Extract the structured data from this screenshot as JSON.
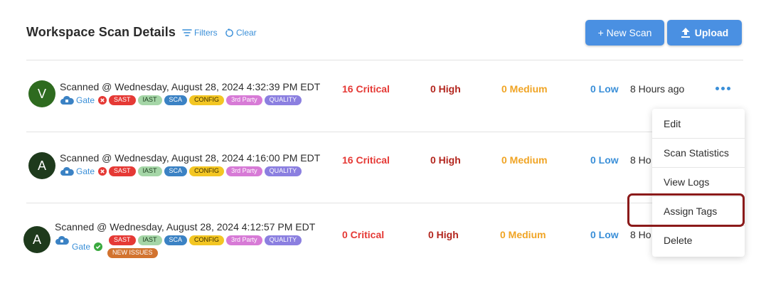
{
  "header": {
    "title": "Workspace Scan Details",
    "filters_label": "Filters",
    "clear_label": "Clear",
    "new_scan_label": "+ New Scan",
    "upload_label": "Upload"
  },
  "rows": [
    {
      "avatar_letter": "V",
      "avatar_color": "#2e6b1f",
      "title": "Scanned @ Wednesday, August 28, 2024 4:32:39 PM EDT",
      "gate_label": "Gate",
      "gate_status": "failed",
      "tags": [
        "SAST",
        "IAST",
        "SCA",
        "CONFIG",
        "3rd Party",
        "QUALITY"
      ],
      "critical": "16 Critical",
      "high": "0 High",
      "medium": "0 Medium",
      "low": "0 Low",
      "ago": "8 Hours ago"
    },
    {
      "avatar_letter": "A",
      "avatar_color": "#1e3a1c",
      "title": "Scanned @ Wednesday, August 28, 2024 4:16:00 PM EDT",
      "gate_label": "Gate",
      "gate_status": "failed",
      "tags": [
        "SAST",
        "IAST",
        "SCA",
        "CONFIG",
        "3rd Party",
        "QUALITY"
      ],
      "critical": "16 Critical",
      "high": "0 High",
      "medium": "0 Medium",
      "low": "0 Low",
      "ago": "8 Ho"
    },
    {
      "avatar_letter": "A",
      "avatar_color": "#1e3a1c",
      "title": "Scanned @ Wednesday, August 28, 2024 4:12:57 PM EDT",
      "gate_label": "Gate",
      "gate_status": "passed",
      "tags": [
        "SAST",
        "IAST",
        "SCA",
        "CONFIG",
        "3rd Party",
        "QUALITY"
      ],
      "extra_tag": "NEW ISSUES",
      "critical": "0 Critical",
      "high": "0 High",
      "medium": "0 Medium",
      "low": "0 Low",
      "ago": "8 Ho"
    }
  ],
  "menu": {
    "items": [
      "Edit",
      "Scan Statistics",
      "View Logs",
      "Assign Tags",
      "Delete"
    ],
    "highlighted": "Assign Tags"
  },
  "colors": {
    "accent": "#4a90e2",
    "link": "#3a8fd8",
    "critical": "#e53935",
    "high": "#b3261e",
    "medium": "#f0a424",
    "highlight_border": "#8b1a1a"
  },
  "icons": {
    "filters": "filter-lines-icon",
    "clear": "refresh-icon",
    "upload": "upload-arrow-icon",
    "gate": "cloud-lock-icon",
    "gate_failed": "x-circle-icon",
    "gate_passed": "check-circle-icon",
    "more": "ellipsis-horizontal-icon"
  }
}
